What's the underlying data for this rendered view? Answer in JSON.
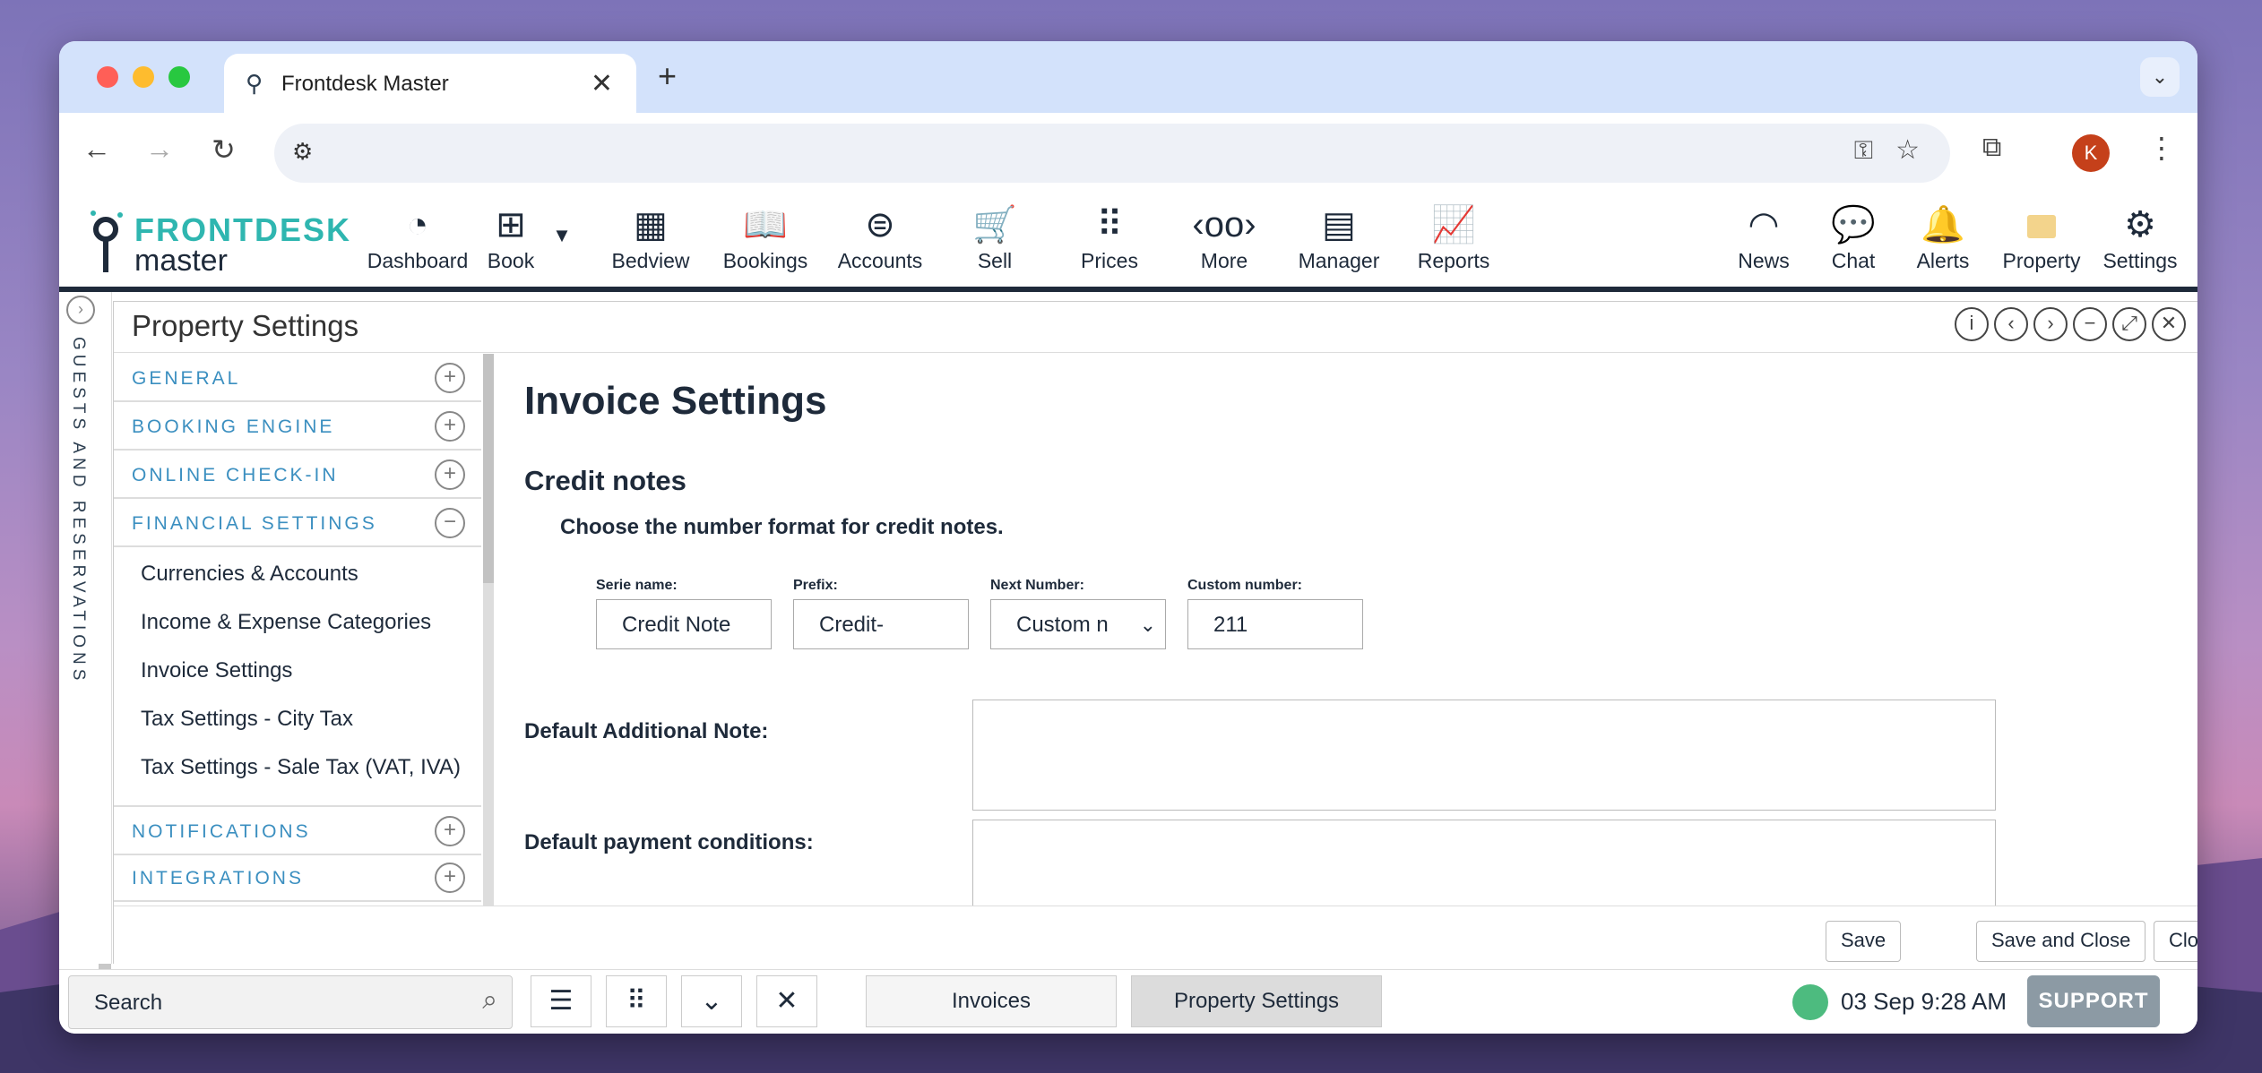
{
  "browser": {
    "tab_title": "Frontdesk Master",
    "profile_initial": "K"
  },
  "app": {
    "logo_top": "FRONTDESK",
    "logo_bottom": "master",
    "nav": [
      {
        "label": "Dashboard",
        "icon": "gauge-icon"
      },
      {
        "label": "Book",
        "icon": "plus-square-icon"
      },
      {
        "label": "Bedview",
        "icon": "grid-icon"
      },
      {
        "label": "Bookings",
        "icon": "book-open-icon"
      },
      {
        "label": "Accounts",
        "icon": "coin-search-icon"
      },
      {
        "label": "Sell",
        "icon": "cart-icon"
      },
      {
        "label": "Prices",
        "icon": "dots-grid-icon"
      },
      {
        "label": "More",
        "icon": "more-icon"
      },
      {
        "label": "Manager",
        "icon": "building-icon"
      },
      {
        "label": "Reports",
        "icon": "chart-icon"
      }
    ],
    "nav_right": [
      {
        "label": "News",
        "icon": "rss-icon"
      },
      {
        "label": "Chat",
        "icon": "chat-icon"
      },
      {
        "label": "Alerts",
        "icon": "bell-icon"
      },
      {
        "label": "Property",
        "icon": "property-icon"
      },
      {
        "label": "Settings",
        "icon": "gear-icon"
      }
    ],
    "side_strip": "GUESTS AND RESERVATIONS"
  },
  "panel": {
    "title": "Property Settings",
    "menu": {
      "sections": [
        {
          "label": "GENERAL",
          "state": "+"
        },
        {
          "label": "BOOKING ENGINE",
          "state": "+"
        },
        {
          "label": "ONLINE CHECK-IN",
          "state": "+"
        },
        {
          "label": "FINANCIAL SETTINGS",
          "state": "−"
        }
      ],
      "financial_items": [
        "Currencies & Accounts",
        "Income & Expense Categories",
        "Invoice Settings",
        "Tax Settings - City Tax",
        "Tax Settings - Sale Tax (VAT, IVA)"
      ],
      "sections_after": [
        {
          "label": "NOTIFICATIONS",
          "state": "+"
        },
        {
          "label": "INTEGRATIONS",
          "state": "+"
        }
      ]
    },
    "content": {
      "heading": "Invoice Settings",
      "subheading": "Credit notes",
      "description": "Choose the number format for credit notes.",
      "fields": [
        {
          "label": "Serie name:",
          "value": "Credit Note"
        },
        {
          "label": "Prefix:",
          "value": "Credit-"
        },
        {
          "label": "Next Number:",
          "value": "Custom n"
        },
        {
          "label": "Custom number:",
          "value": "211"
        }
      ],
      "additional_note_label": "Default Additional Note:",
      "payment_conditions_label": "Default payment conditions:"
    },
    "footer": {
      "save": "Save",
      "save_close": "Save and Close",
      "close": "Close"
    }
  },
  "bottom": {
    "search": "Search",
    "tabs": [
      "Invoices",
      "Property Settings"
    ],
    "datetime": "03 Sep 9:28 AM",
    "support": "SUPPORT"
  }
}
